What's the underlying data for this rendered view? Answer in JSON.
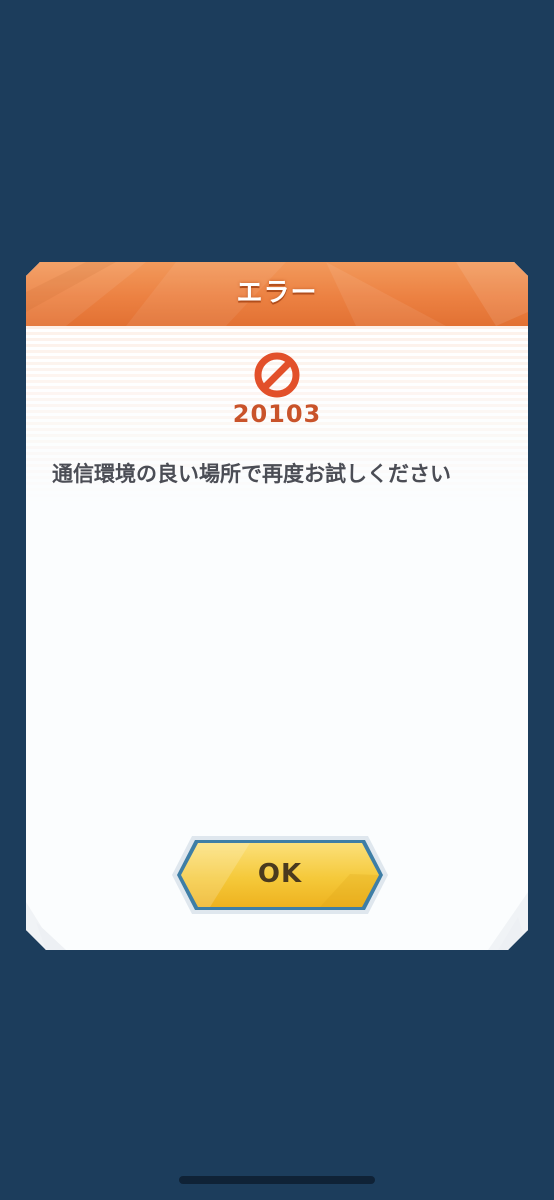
{
  "dialog": {
    "title": "エラー",
    "icon": "prohibited-icon",
    "error_code": "20103",
    "message": "通信環境の良い場所で再度お試しください",
    "ok_label": "OK"
  },
  "colors": {
    "background": "#1c3d5c",
    "header": "#ec8142",
    "accent": "#e2502a",
    "button": "#f5c93a"
  }
}
